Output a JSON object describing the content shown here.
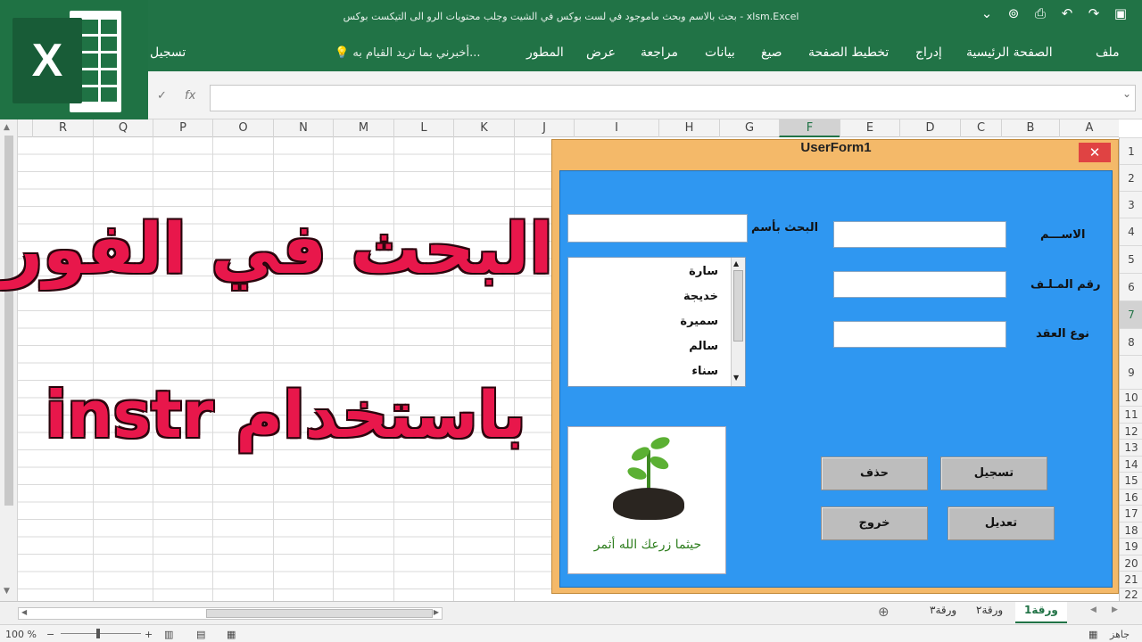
{
  "window": {
    "title": "بحث بالاسم وبحث ماموجود في لست بوكس في الشيت وجلب محتويات الرو الى التيكست بوكس - xlsm.Excel"
  },
  "ribbon": {
    "tabs": [
      "ملف",
      "الصفحة الرئيسية",
      "إدراج",
      "تخطيط الصفحة",
      "صيغ",
      "بيانات",
      "مراجعة",
      "عرض",
      "المطور"
    ],
    "tell_me": "أخبرني بما تريد القيام به...",
    "signin": "تسجيل"
  },
  "formula_bar": {
    "fx": "fx",
    "cancel": "✕",
    "enter": "✓"
  },
  "columns": [
    "A",
    "B",
    "C",
    "D",
    "E",
    "F",
    "G",
    "H",
    "I",
    "J",
    "K",
    "L",
    "M",
    "N",
    "O",
    "P",
    "Q",
    "R"
  ],
  "selected_column": "F",
  "rows": [
    "1",
    "2",
    "3",
    "4",
    "5",
    "6",
    "7",
    "8",
    "9",
    "10",
    "11",
    "12",
    "13",
    "14",
    "15",
    "16",
    "17",
    "18",
    "19",
    "20",
    "21",
    "22"
  ],
  "selected_row": "7",
  "overlay": {
    "line1": "البحث في الفورم",
    "line2": "باستخدام instr"
  },
  "userform": {
    "title": "UserForm1",
    "close": "✕",
    "labels": {
      "name": "الاســـم",
      "file_number": "رقم المـلـف",
      "contract_type": "نوع العقد",
      "search_by_name": "البحث بأسم"
    },
    "textboxes": {
      "name": "",
      "file_number": "",
      "contract_type": "",
      "search": ""
    },
    "list_items": [
      "سارة",
      "خديجة",
      "سميرة",
      "سالم",
      "سناء"
    ],
    "image_caption": "حيثما زرعك الله أثمر",
    "buttons": {
      "register": "تسجيل",
      "delete": "حذف",
      "edit": "تعديل",
      "exit": "خروج"
    }
  },
  "sheets": {
    "tabs": [
      "ورقة1",
      "ورقة٢",
      "ورقة٣"
    ],
    "active": "ورقة1"
  },
  "status": {
    "ready": "جاهز",
    "zoom": "100 %"
  }
}
